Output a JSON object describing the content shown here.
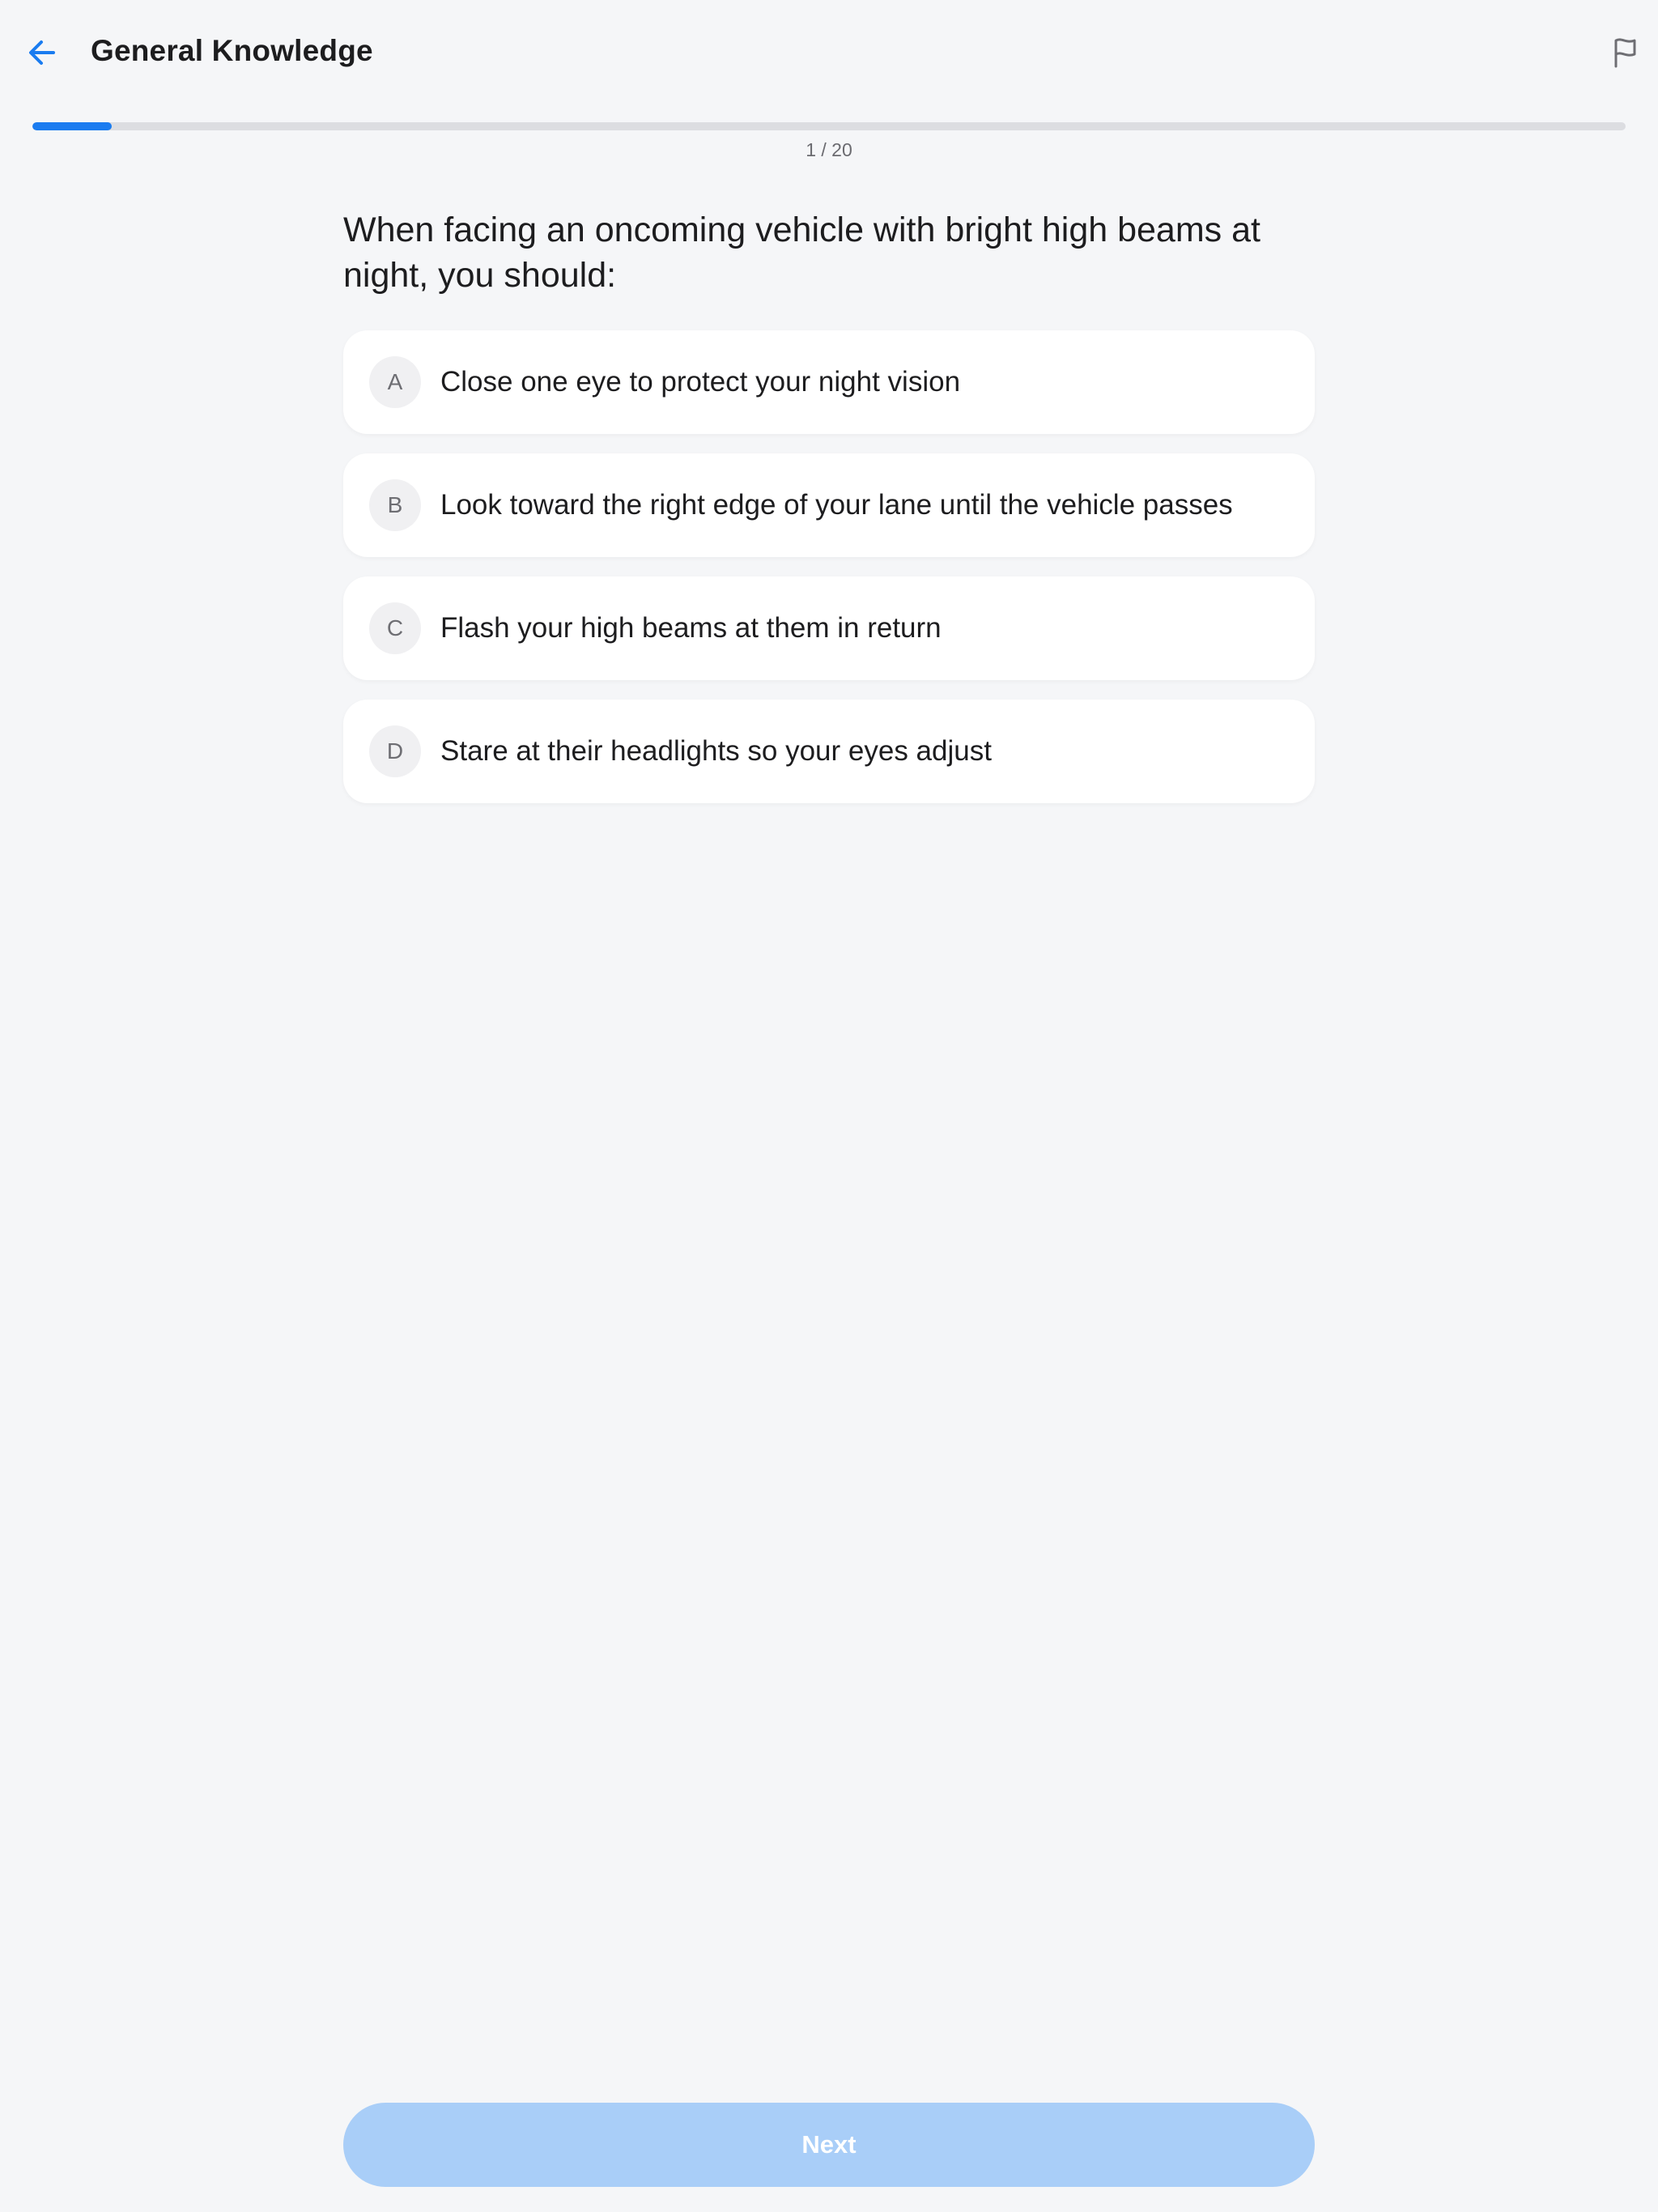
{
  "header": {
    "title": "General Knowledge",
    "back_icon": "arrow-left-icon",
    "flag_icon": "flag-icon"
  },
  "progress": {
    "current": 1,
    "total": 20,
    "label": "1 / 20",
    "fraction": 0.05
  },
  "question": {
    "text": "When facing an oncoming vehicle with bright high beams at night, you should:"
  },
  "options": [
    {
      "letter": "A",
      "text": "Close one eye to protect your night vision"
    },
    {
      "letter": "B",
      "text": "Look toward the right edge of your lane until the vehicle passes"
    },
    {
      "letter": "C",
      "text": "Flash your high beams at them in return"
    },
    {
      "letter": "D",
      "text": "Stare at their headlights so your eyes adjust"
    }
  ],
  "next_button": {
    "label": "Next",
    "enabled": false
  },
  "colors": {
    "accent": "#1a7cf0",
    "background": "#f5f6f8",
    "disabled_button": "#a9cef8",
    "track": "#dcdde1"
  }
}
